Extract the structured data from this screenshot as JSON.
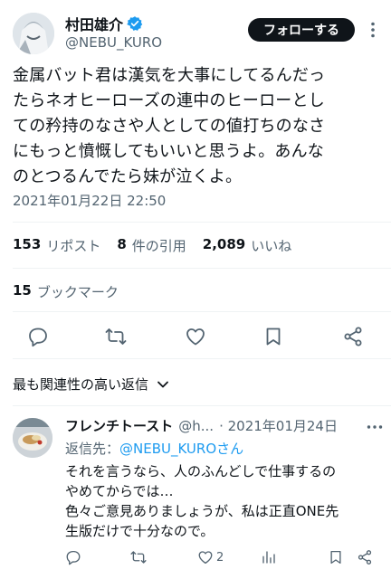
{
  "tweet": {
    "author_name": "村田雄介",
    "author_handle": "@NEBU_KURO",
    "follow_label": "フォローする",
    "text": "金属バット君は漢気を大事にしてるんだっ\nたらネオヒーローズの連中のヒーローとし\nての矜持のなさや人としての値打ちのなさ\nにもっと憤慨してもいいと思うよ。あんな\nのとつるんでたら妹が泣くよ。",
    "timestamp": "2021年01月22日 22:50",
    "stats": {
      "reposts_count": "153",
      "reposts_label": "リポスト",
      "quotes_count": "8",
      "quotes_label": "件の引用",
      "likes_count": "2,089",
      "likes_label": "いいね"
    },
    "bookmarks_count": "15",
    "bookmarks_label": "ブックマーク"
  },
  "replies_sort_label": "最も関連性の高い返信",
  "reply": {
    "author_name": "フレンチトースト",
    "author_handle": "@h...",
    "date": "· 2021年01月24日",
    "reply_to_prefix": "返信先：",
    "reply_to_mention": "@NEBU_KUROさん",
    "text": "それを言うなら、人のふんどしで仕事するの\nやめてからでは…\n色々ご意見ありましょうが、私は正直ONE先\n生版だけで十分なので。",
    "likes_count": "2"
  },
  "icons": {
    "verified": "verified-badge-icon",
    "more": "more-icon",
    "reply": "reply-icon",
    "repost": "repost-icon",
    "like": "like-icon",
    "bookmark": "bookmark-icon",
    "share": "share-icon",
    "views": "views-icon",
    "chevron": "chevron-down-icon"
  },
  "colors": {
    "text_primary": "#0f1419",
    "text_secondary": "#536471",
    "accent": "#1d9bf0",
    "divider": "#eff3f4"
  }
}
